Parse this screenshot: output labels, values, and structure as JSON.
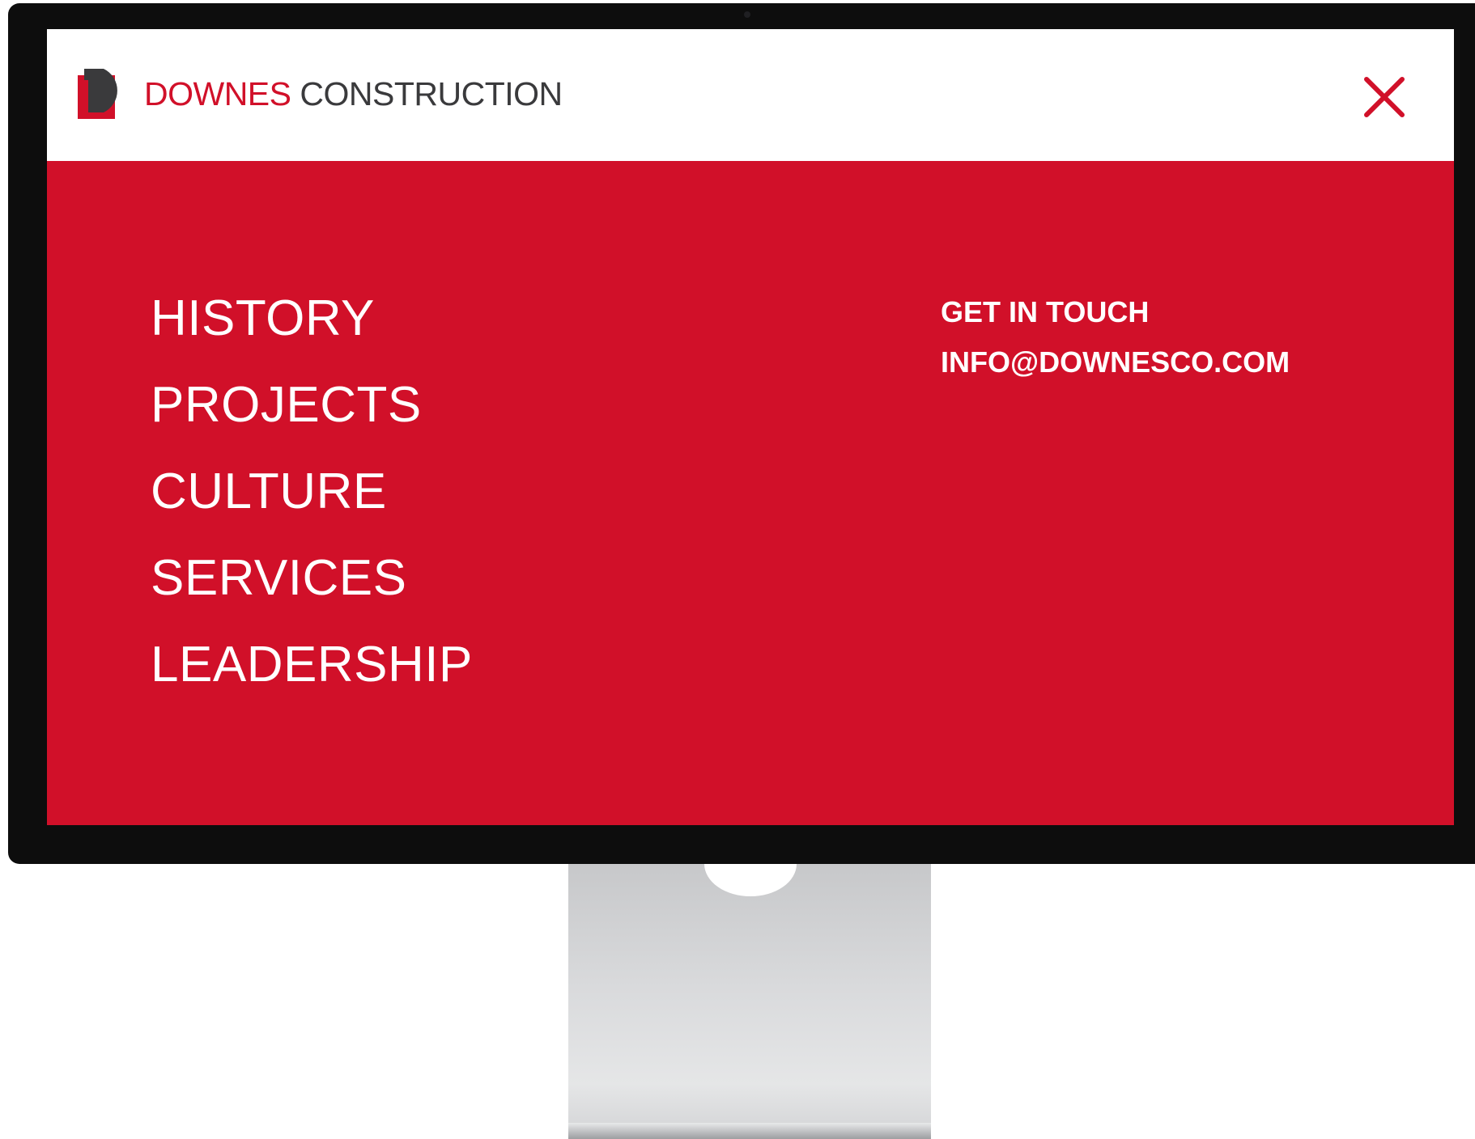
{
  "brand": {
    "name_part1": "DOWNES",
    "name_part2": "CONSTRUCTION",
    "logo_icon": "d-logo-icon"
  },
  "header": {
    "close_icon": "close-icon"
  },
  "nav": {
    "items": [
      {
        "label": "HISTORY"
      },
      {
        "label": "PROJECTS"
      },
      {
        "label": "CULTURE"
      },
      {
        "label": "SERVICES"
      },
      {
        "label": "LEADERSHIP"
      }
    ]
  },
  "contact": {
    "heading": "GET IN TOUCH",
    "email": "INFO@DOWNESCO.COM"
  },
  "colors": {
    "brand_red": "#d11029",
    "brand_dark": "#3a3a3c",
    "text_on_red": "#ffffff"
  }
}
